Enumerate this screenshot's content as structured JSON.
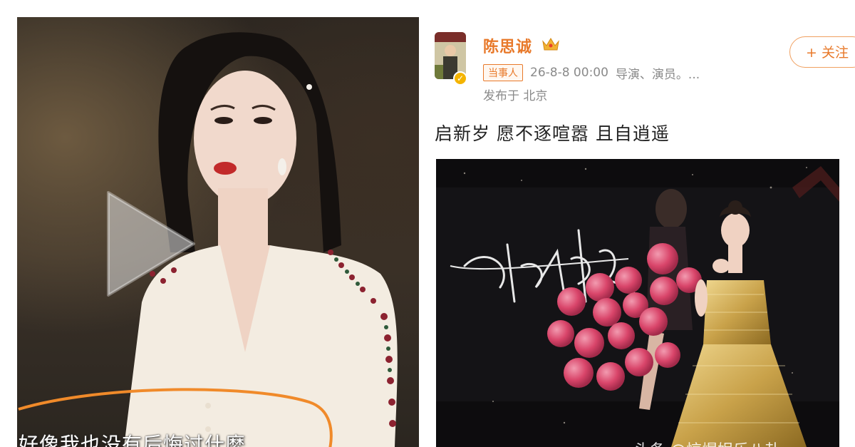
{
  "video_frame": {
    "caption": "好像我也没有后悔过什麽",
    "play_icon": "play-icon"
  },
  "weibo_post": {
    "user_name": "陈思诚",
    "crown_icon": "crown-icon",
    "verified_icon": "verified-badge-icon",
    "tag": "当事人",
    "timestamp": "26-8-8 00:00",
    "roles": "导演、演员。...",
    "location": "发布于 北京",
    "follow_label": "+ 关注",
    "content": "启新岁 愿不逐喧嚣 且自逍遥",
    "photo_watermark": "头条 @惊爆娱乐八卦"
  },
  "colors": {
    "accent_orange": "#e8792a",
    "meta_gray": "#8a8a8a",
    "balloon_pink": "#d9456a",
    "dress_gold": "#c9a24a"
  }
}
